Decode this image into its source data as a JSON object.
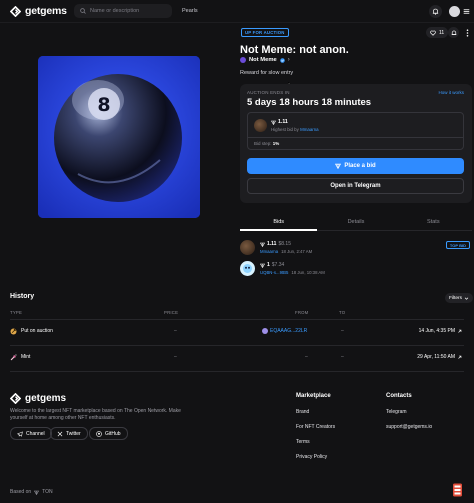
{
  "header": {
    "logo_text": "getgems",
    "search_placeholder": "Name or description",
    "nav_pearls": "Pearls"
  },
  "nft": {
    "badge": "UP FOR AUCTION",
    "likes": "11",
    "title": "Not Meme: not anon.",
    "collection": "Not Meme",
    "description": "Reward for slow entry"
  },
  "auction": {
    "ends_label": "AUCTION ENDS IN",
    "how_link": "How it works",
    "countdown": "5 days 18 hours 18 minutes",
    "highest_amount": "1.11",
    "highest_by_prefix": "Highest bid by",
    "highest_by_user": "Mmaarna",
    "bid_step_label": "Bid step:",
    "bid_step_value": "1%",
    "place_bid": "Place a bid",
    "open_telegram": "Open in Telegram"
  },
  "tabs": [
    "Bids",
    "Details",
    "Stats"
  ],
  "bids": [
    {
      "amount": "1.11",
      "fiat": "$8.15",
      "user": "Mmaarna",
      "time": "18 Jun, 2:47 AM",
      "badge": "TOP BID"
    },
    {
      "amount": "1",
      "fiat": "$7.34",
      "user": "UQBN-s...9tB5",
      "time": "18 Jun, 10:38 AM",
      "badge": ""
    }
  ],
  "history": {
    "title": "History",
    "filters": "Filters",
    "columns": [
      "TYPE",
      "PRICE",
      "FROM",
      "TO"
    ],
    "rows": [
      {
        "type": "Put on auction",
        "price": "–",
        "from": "EQAAAG...22LR",
        "to": "–",
        "date": "14 Jun, 4:35 PM"
      },
      {
        "type": "Mint",
        "price": "–",
        "from": "–",
        "to": "–",
        "date": "29 Apr, 11:50 AM"
      }
    ]
  },
  "footer": {
    "logo_text": "getgems",
    "description": "Welcome to the largest NFT marketplace based on The Open Network. Make yourself at home among other NFT enthusiasts.",
    "social": [
      "Channel",
      "Twitter",
      "GitHub"
    ],
    "marketplace_title": "Marketplace",
    "marketplace_links": [
      "Brand",
      "For NFT Creators",
      "Terms",
      "Privacy Policy"
    ],
    "contacts_title": "Contacts",
    "contacts_links": [
      "Telegram",
      "support@getgems.io"
    ],
    "based_on_prefix": "Based on",
    "based_on": "TON"
  },
  "colors": {
    "background": "#121214",
    "accent": "#2f8bff",
    "card": "#1d1d20"
  },
  "icons": [
    "getgems-logo-icon",
    "search-icon",
    "bell-icon",
    "avatar-icon",
    "menu-icon",
    "heart-icon",
    "more-icon",
    "verified-icon",
    "ton-icon",
    "telegram-icon",
    "chevron-down-icon",
    "auction-icon",
    "mint-icon",
    "twitter-icon",
    "github-icon"
  ]
}
